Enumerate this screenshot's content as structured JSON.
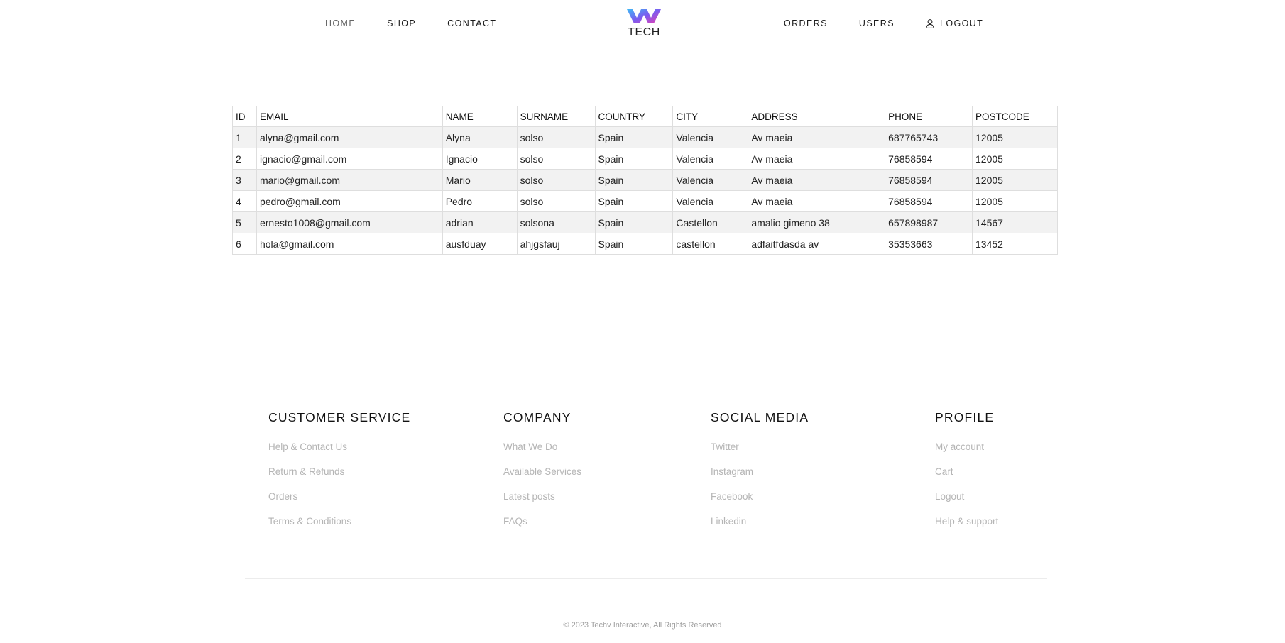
{
  "header": {
    "nav_left": [
      {
        "label": "HOME",
        "active": true
      },
      {
        "label": "SHOP",
        "active": false
      },
      {
        "label": "CONTACT",
        "active": false
      }
    ],
    "logo_text": "TECH",
    "logo_icon": "w-logo-icon",
    "logo_colors": [
      "#3fb8f5",
      "#7b5cf0",
      "#e63fb2"
    ],
    "nav_right": [
      {
        "label": "ORDERS"
      },
      {
        "label": "USERS"
      }
    ],
    "logout_label": "LOGOUT",
    "logout_icon": "user-icon"
  },
  "users_table": {
    "columns": [
      "ID",
      "EMAIL",
      "NAME",
      "SURNAME",
      "COUNTRY",
      "CITY",
      "ADDRESS",
      "PHONE",
      "POSTCODE"
    ],
    "rows": [
      [
        "1",
        "alyna@gmail.com",
        "Alyna",
        "solso",
        "Spain",
        "Valencia",
        "Av maeia",
        "687765743",
        "12005"
      ],
      [
        "2",
        "ignacio@gmail.com",
        "Ignacio",
        "solso",
        "Spain",
        "Valencia",
        "Av maeia",
        "76858594",
        "12005"
      ],
      [
        "3",
        "mario@gmail.com",
        "Mario",
        "solso",
        "Spain",
        "Valencia",
        "Av maeia",
        "76858594",
        "12005"
      ],
      [
        "4",
        "pedro@gmail.com",
        "Pedro",
        "solso",
        "Spain",
        "Valencia",
        "Av maeia",
        "76858594",
        "12005"
      ],
      [
        "5",
        "ernesto1008@gmail.com",
        "adrian",
        "solsona",
        "Spain",
        "Castellon",
        "amalio gimeno 38",
        "657898987",
        "14567"
      ],
      [
        "6",
        "hola@gmail.com",
        "ausfduay",
        "ahjgsfauj",
        "Spain",
        "castellon",
        "adfaitfdasda av",
        "35353663",
        "13452"
      ]
    ]
  },
  "footer": {
    "columns": [
      {
        "title": "CUSTOMER SERVICE",
        "links": [
          "Help & Contact Us",
          "Return & Refunds",
          "Orders",
          "Terms & Conditions"
        ]
      },
      {
        "title": "COMPANY",
        "links": [
          "What We Do",
          "Available Services",
          "Latest posts",
          "FAQs"
        ]
      },
      {
        "title": "SOCIAL MEDIA",
        "links": [
          "Twitter",
          "Instagram",
          "Facebook",
          "Linkedin"
        ]
      },
      {
        "title": "PROFILE",
        "links": [
          "My account",
          "Cart",
          "Logout",
          "Help & support"
        ]
      }
    ],
    "copyright": "© 2023 Techv Interactive, All Rights Reserved"
  }
}
